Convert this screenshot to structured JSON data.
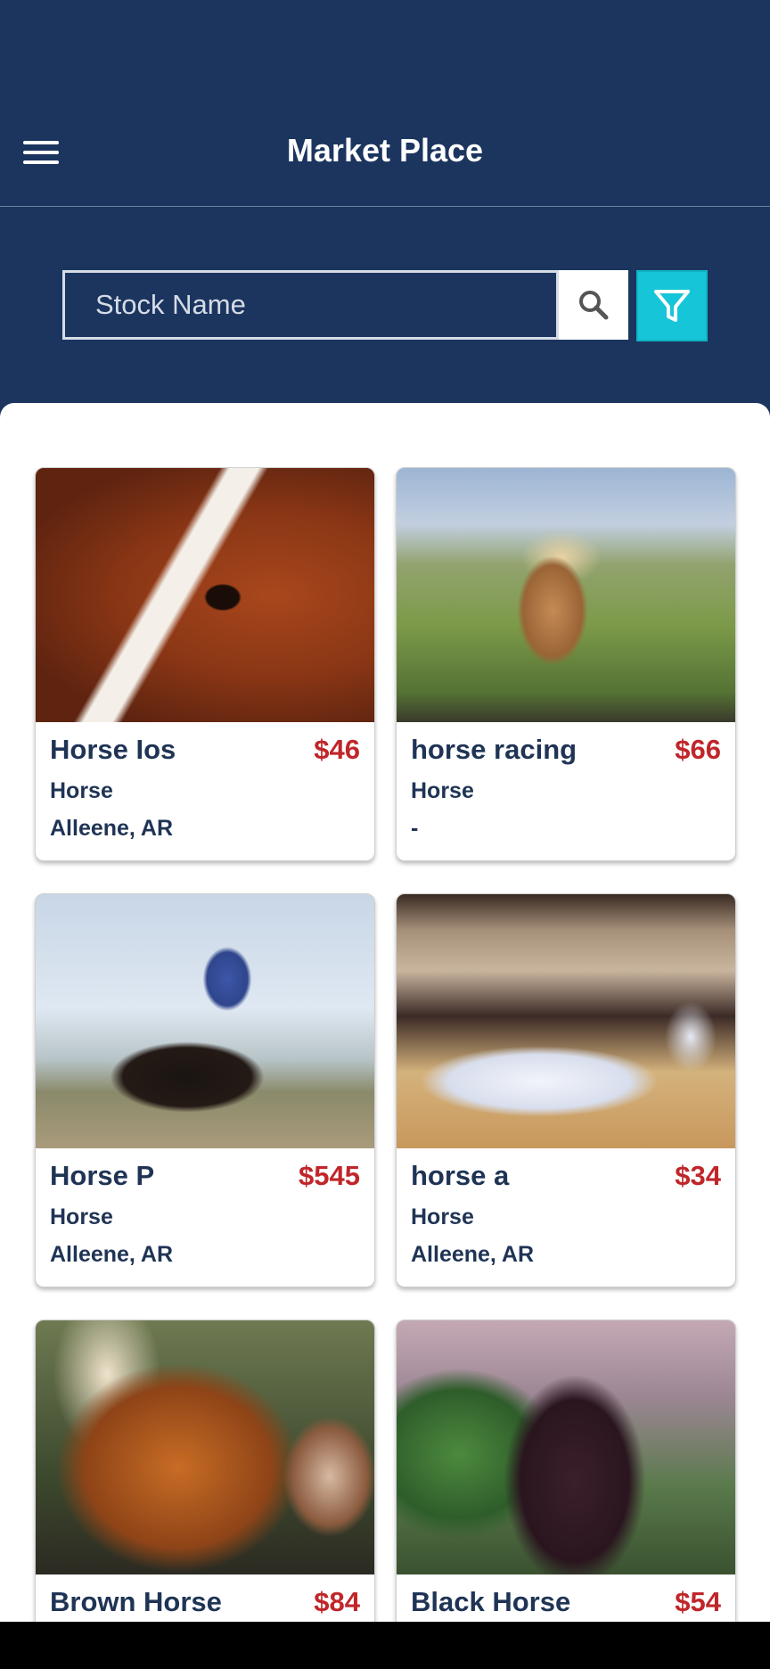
{
  "header": {
    "title": "Market Place",
    "menu_icon": "hamburger-menu-icon"
  },
  "search": {
    "placeholder": "Stock Name",
    "search_icon": "search-icon",
    "filter_icon": "filter-icon"
  },
  "colors": {
    "header_background": "#1b355f",
    "filter_button": "#16c6d8",
    "price": "#c0262a",
    "text": "#1f3455"
  },
  "listings": [
    {
      "name": "Horse Ios",
      "price": "$46",
      "type": "Horse",
      "location": "Alleene, AR"
    },
    {
      "name": "horse racing",
      "price": "$66",
      "type": "Horse",
      "location": "-"
    },
    {
      "name": "Horse P",
      "price": "$545",
      "type": "Horse",
      "location": "Alleene, AR"
    },
    {
      "name": "horse a",
      "price": "$34",
      "type": "Horse",
      "location": "Alleene, AR"
    },
    {
      "name": "Brown Horse",
      "price": "$84",
      "type": "",
      "location": ""
    },
    {
      "name": "Black Horse",
      "price": "$54",
      "type": "",
      "location": ""
    }
  ]
}
